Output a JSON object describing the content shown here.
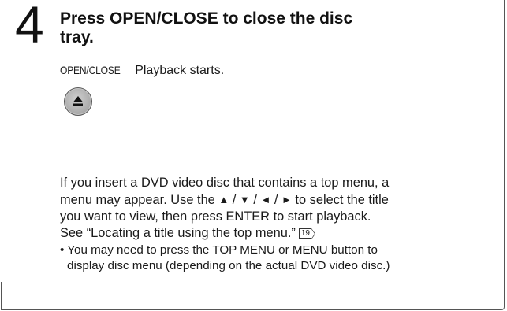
{
  "step": {
    "number": "4",
    "title_line1": "Press OPEN/CLOSE to close the disc",
    "title_line2": "tray."
  },
  "button": {
    "label": "OPEN/CLOSE",
    "description": "Playback starts.",
    "icon": "eject-icon"
  },
  "paragraph": {
    "line1": "If you insert a DVD video disc that contains a top menu, a",
    "line2_pre": "menu may appear. Use the ",
    "arrow_up": "▲",
    "arrow_sep1": " / ",
    "arrow_down": "▼",
    "arrow_sep2": " / ",
    "arrow_left": "◄",
    "arrow_sep3": " / ",
    "arrow_right": "►",
    "line2_post": " to select the  title",
    "line3": "you want to view, then press ENTER to start playback.",
    "line4": "See “Locating a title using the top menu.”",
    "page_ref": "19"
  },
  "note": {
    "line1": "• You may need to press the TOP MENU or MENU button to",
    "line2": "display disc menu (depending on the actual DVD video disc.)"
  }
}
